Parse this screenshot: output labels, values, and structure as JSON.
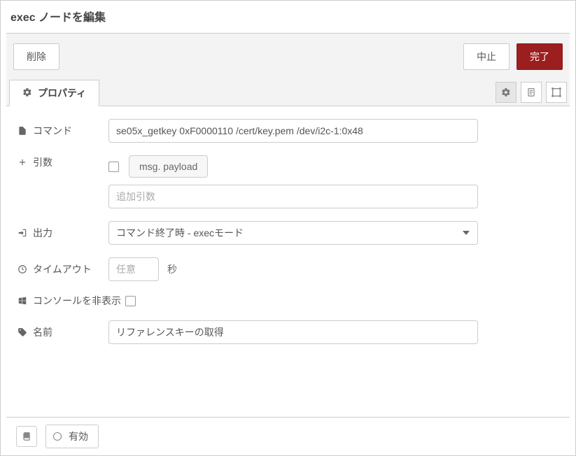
{
  "header": {
    "title": "exec ノードを編集"
  },
  "toolbar": {
    "delete_label": "削除",
    "cancel_label": "中止",
    "done_label": "完了"
  },
  "tabs": {
    "properties_label": "プロパティ"
  },
  "form": {
    "command": {
      "label": "コマンド",
      "value": "se05x_getkey 0xF0000110 /cert/key.pem /dev/i2c-1:0x48"
    },
    "append": {
      "label": "引数",
      "msg_pill": "msg. payload",
      "extra_placeholder": "追加引数"
    },
    "output": {
      "label": "出力",
      "selected": "コマンド終了時 - execモード"
    },
    "timeout": {
      "label": "タイムアウト",
      "placeholder": "任意",
      "unit": "秒"
    },
    "hideconsole": {
      "label": "コンソールを非表示"
    },
    "name": {
      "label": "名前",
      "value": "リファレンスキーの取得"
    }
  },
  "footer": {
    "enabled_label": "有効"
  }
}
